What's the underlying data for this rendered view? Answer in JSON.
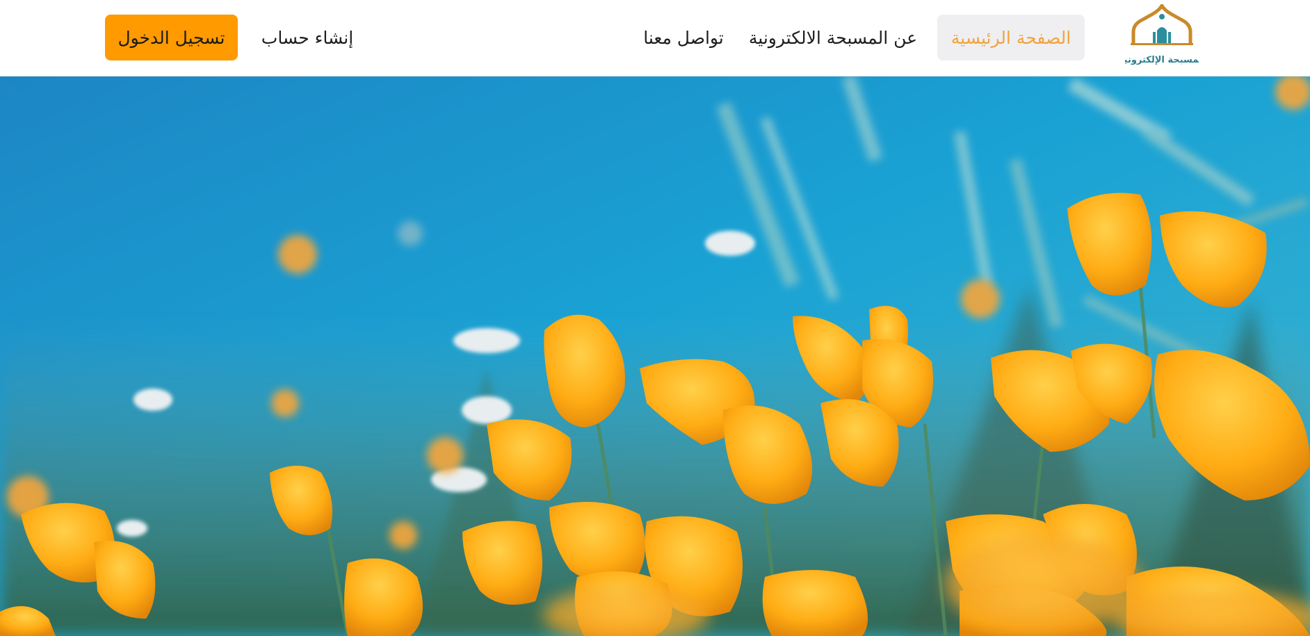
{
  "header": {
    "logo_text": "المسبحة الإلكترونية",
    "nav": {
      "home": "الصفحة الرئيسية",
      "about": "عن المسبحة الالكترونية",
      "contact": "تواصل معنا",
      "register": "إنشاء حساب"
    },
    "login_button": "تسجيل الدخول"
  },
  "hero": {
    "image": "orange-poppies-against-blue-sky"
  },
  "colors": {
    "accent": "#ff9a00",
    "active_nav_text": "#f2a33a",
    "active_nav_bg": "#efeff1",
    "logo_gold": "#c98a2a",
    "logo_teal": "#2a8f9c",
    "sky": "#1a8fc8"
  }
}
